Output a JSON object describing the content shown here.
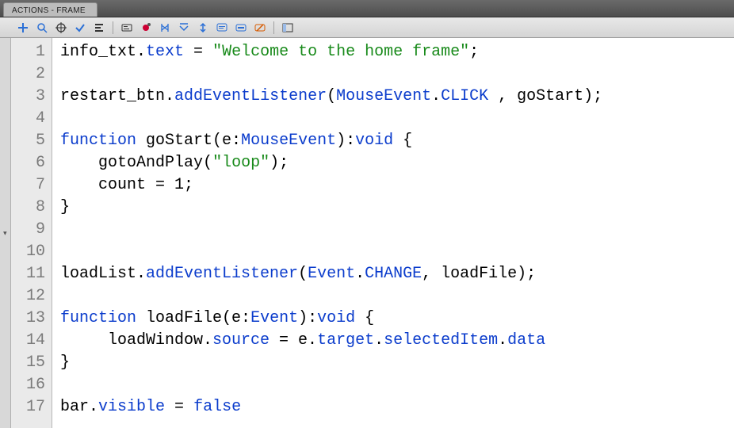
{
  "panel": {
    "title": "ACTIONS - FRAME"
  },
  "toolbar": {
    "items": [
      {
        "name": "add-script-icon"
      },
      {
        "name": "find-icon"
      },
      {
        "name": "target-icon"
      },
      {
        "name": "check-syntax-icon"
      },
      {
        "name": "auto-format-icon"
      },
      {
        "name": "code-hint-icon"
      },
      {
        "name": "debug-options-icon"
      },
      {
        "name": "collapse-between-icon"
      },
      {
        "name": "collapse-selection-icon"
      },
      {
        "name": "expand-all-icon"
      },
      {
        "name": "comment-block-icon"
      },
      {
        "name": "comment-line-icon"
      },
      {
        "name": "uncomment-icon"
      },
      {
        "name": "show-hide-toolbox-icon"
      }
    ]
  },
  "code": {
    "lines": [
      {
        "n": 1,
        "tokens": [
          [
            "id",
            "info_txt"
          ],
          [
            "pn",
            "."
          ],
          [
            "prop",
            "text"
          ],
          [
            "pn",
            " = "
          ],
          [
            "str",
            "\"Welcome to the home frame\""
          ],
          [
            "pn",
            ";"
          ]
        ]
      },
      {
        "n": 2,
        "tokens": []
      },
      {
        "n": 3,
        "tokens": [
          [
            "id",
            "restart_btn"
          ],
          [
            "pn",
            "."
          ],
          [
            "prop",
            "addEventListener"
          ],
          [
            "pn",
            "("
          ],
          [
            "type",
            "MouseEvent"
          ],
          [
            "pn",
            "."
          ],
          [
            "prop",
            "CLICK"
          ],
          [
            "pn",
            " , goStart);"
          ]
        ]
      },
      {
        "n": 4,
        "tokens": []
      },
      {
        "n": 5,
        "tokens": [
          [
            "kw",
            "function"
          ],
          [
            "pn",
            " "
          ],
          [
            "id",
            "goStart"
          ],
          [
            "pn",
            "(e:"
          ],
          [
            "type",
            "MouseEvent"
          ],
          [
            "pn",
            "):"
          ],
          [
            "kw",
            "void"
          ],
          [
            "pn",
            " {"
          ]
        ]
      },
      {
        "n": 6,
        "tokens": [
          [
            "pn",
            "    "
          ],
          [
            "id",
            "gotoAndPlay"
          ],
          [
            "pn",
            "("
          ],
          [
            "str",
            "\"loop\""
          ],
          [
            "pn",
            ");"
          ]
        ]
      },
      {
        "n": 7,
        "tokens": [
          [
            "pn",
            "    count = 1;"
          ]
        ]
      },
      {
        "n": 8,
        "tokens": [
          [
            "pn",
            "}"
          ]
        ]
      },
      {
        "n": 9,
        "tokens": []
      },
      {
        "n": 10,
        "tokens": []
      },
      {
        "n": 11,
        "tokens": [
          [
            "id",
            "loadList"
          ],
          [
            "pn",
            "."
          ],
          [
            "prop",
            "addEventListener"
          ],
          [
            "pn",
            "("
          ],
          [
            "type",
            "Event"
          ],
          [
            "pn",
            "."
          ],
          [
            "prop",
            "CHANGE"
          ],
          [
            "pn",
            ", loadFile);"
          ]
        ]
      },
      {
        "n": 12,
        "tokens": []
      },
      {
        "n": 13,
        "tokens": [
          [
            "kw",
            "function"
          ],
          [
            "pn",
            " "
          ],
          [
            "id",
            "loadFile"
          ],
          [
            "pn",
            "(e:"
          ],
          [
            "type",
            "Event"
          ],
          [
            "pn",
            "):"
          ],
          [
            "kw",
            "void"
          ],
          [
            "pn",
            " {"
          ]
        ]
      },
      {
        "n": 14,
        "tokens": [
          [
            "pn",
            "     loadWindow."
          ],
          [
            "prop",
            "source"
          ],
          [
            "pn",
            " = e."
          ],
          [
            "prop",
            "target"
          ],
          [
            "pn",
            "."
          ],
          [
            "prop",
            "selectedItem"
          ],
          [
            "pn",
            "."
          ],
          [
            "prop",
            "data"
          ]
        ]
      },
      {
        "n": 15,
        "tokens": [
          [
            "pn",
            "}"
          ]
        ]
      },
      {
        "n": 16,
        "tokens": []
      },
      {
        "n": 17,
        "tokens": [
          [
            "id",
            "bar"
          ],
          [
            "pn",
            "."
          ],
          [
            "prop",
            "visible"
          ],
          [
            "pn",
            " = "
          ],
          [
            "kw",
            "false"
          ]
        ]
      }
    ]
  }
}
